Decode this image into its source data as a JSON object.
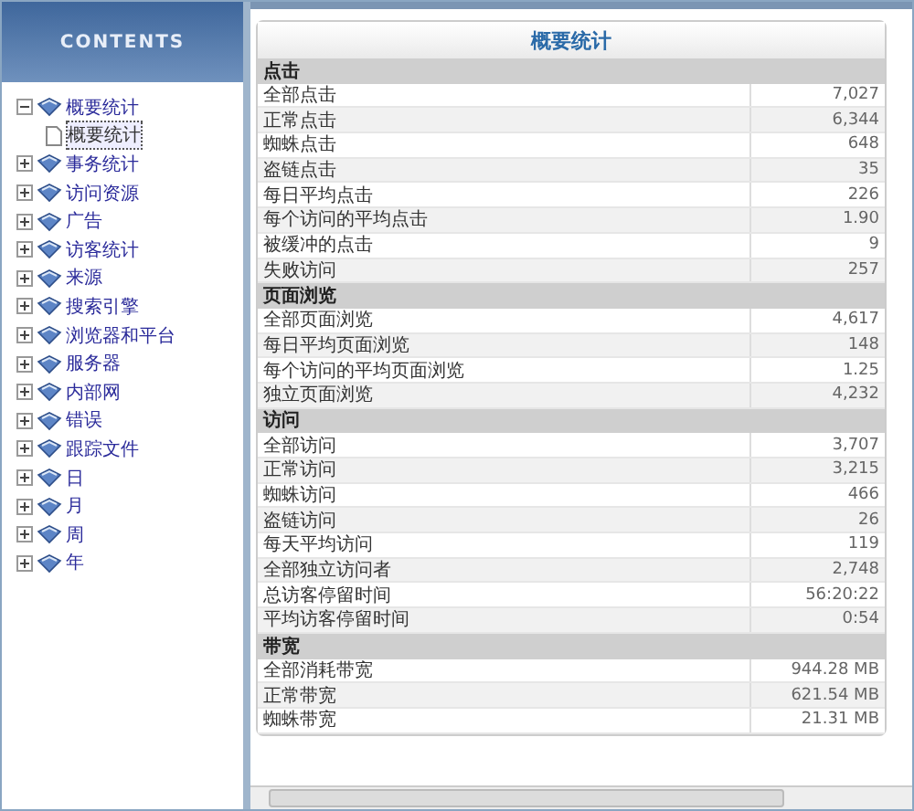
{
  "sidebar": {
    "title": "CONTENTS",
    "tree": [
      {
        "label": "概要统计",
        "expanded": true,
        "children": [
          {
            "label": "概要统计",
            "selected": true
          }
        ]
      },
      {
        "label": "事务统计",
        "expanded": false
      },
      {
        "label": "访问资源",
        "expanded": false
      },
      {
        "label": "广告",
        "expanded": false
      },
      {
        "label": "访客统计",
        "expanded": false
      },
      {
        "label": "来源",
        "expanded": false
      },
      {
        "label": "搜索引擎",
        "expanded": false
      },
      {
        "label": "浏览器和平台",
        "expanded": false
      },
      {
        "label": "服务器",
        "expanded": false
      },
      {
        "label": "内部网",
        "expanded": false
      },
      {
        "label": "错误",
        "expanded": false
      },
      {
        "label": "跟踪文件",
        "expanded": false
      },
      {
        "label": "日",
        "expanded": false
      },
      {
        "label": "月",
        "expanded": false
      },
      {
        "label": "周",
        "expanded": false
      },
      {
        "label": "年",
        "expanded": false
      }
    ]
  },
  "report": {
    "title": "概要统计",
    "sections": [
      {
        "heading": "点击",
        "rows": [
          {
            "label": "全部点击",
            "value": "7,027"
          },
          {
            "label": "正常点击",
            "value": "6,344"
          },
          {
            "label": "蜘蛛点击",
            "value": "648"
          },
          {
            "label": "盗链点击",
            "value": "35"
          },
          {
            "label": "每日平均点击",
            "value": "226"
          },
          {
            "label": "每个访问的平均点击",
            "value": "1.90"
          },
          {
            "label": "被缓冲的点击",
            "value": "9"
          },
          {
            "label": "失败访问",
            "value": "257"
          }
        ]
      },
      {
        "heading": "页面浏览",
        "rows": [
          {
            "label": "全部页面浏览",
            "value": "4,617"
          },
          {
            "label": "每日平均页面浏览",
            "value": "148"
          },
          {
            "label": "每个访问的平均页面浏览",
            "value": "1.25"
          },
          {
            "label": "独立页面浏览",
            "value": "4,232"
          }
        ]
      },
      {
        "heading": "访问",
        "rows": [
          {
            "label": "全部访问",
            "value": "3,707"
          },
          {
            "label": "正常访问",
            "value": "3,215"
          },
          {
            "label": "蜘蛛访问",
            "value": "466"
          },
          {
            "label": "盗链访问",
            "value": "26"
          },
          {
            "label": "每天平均访问",
            "value": "119"
          },
          {
            "label": "全部独立访问者",
            "value": "2,748"
          },
          {
            "label": "总访客停留时间",
            "value": "56:20:22"
          },
          {
            "label": "平均访客停留时间",
            "value": "0:54"
          }
        ]
      },
      {
        "heading": "带宽",
        "rows": [
          {
            "label": "全部消耗带宽",
            "value": "944.28 MB"
          },
          {
            "label": "正常带宽",
            "value": "621.54 MB"
          },
          {
            "label": "蜘蛛带宽",
            "value": "21.31 MB"
          }
        ]
      }
    ]
  }
}
